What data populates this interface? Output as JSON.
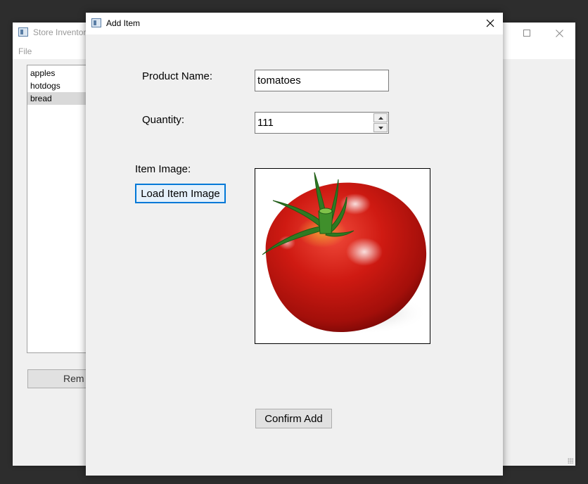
{
  "main_window": {
    "title": "Store Inventor",
    "menu": {
      "file": "File"
    },
    "items": [
      "apples",
      "hotdogs",
      "bread"
    ],
    "selected_index": 2,
    "remove_button": "Rem"
  },
  "dialog": {
    "title": "Add Item",
    "product_name": {
      "label": "Product Name:",
      "value": "tomatoes"
    },
    "quantity": {
      "label": "Quantity:",
      "value": "111"
    },
    "item_image": {
      "label": "Item Image:",
      "button": "Load Item Image",
      "image": "tomato"
    },
    "confirm_button": "Confirm Add"
  },
  "colors": {
    "focus_accent": "#0078d7",
    "selection": "#d9d9d9",
    "tomato_red": "#c4140f"
  },
  "icons": [
    "app-window-icon",
    "close-icon",
    "maximize-icon",
    "spin-up-icon",
    "spin-down-icon",
    "tomato-image"
  ]
}
